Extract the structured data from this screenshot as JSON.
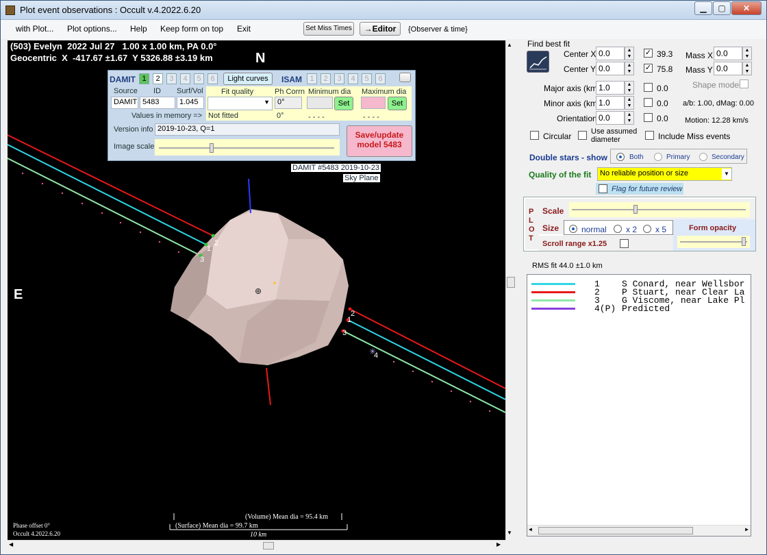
{
  "window": {
    "title": "Plot event observations : Occult v.4.2022.6.20"
  },
  "menu": [
    "with Plot...",
    "Plot options...",
    "Help",
    "Keep form on top",
    "Exit"
  ],
  "toolbar": {
    "set_miss_times": "Set Miss Times",
    "editor": "→Editor",
    "observer_time": "{Observer & time}"
  },
  "plot": {
    "header_line1": "(503) Evelyn  2022 Jul 27   1.00 x 1.00 km, PA 0.0°",
    "header_line2": "Geocentric  X  -417.67 ±1.67  Y 5326.88 ±3.19 km",
    "north_label": "N",
    "east_label": "E",
    "damit_caption": "DAMIT #5483 2019-10-23",
    "sky_plane": "Sky Plane",
    "phase_offset": "Phase offset 0°",
    "version": "Occult 4.2022.6.20",
    "volume_dia": "(Volume) Mean dia = 95.4 km",
    "surface_dia": "(Surface) Mean dia = 99.7 km",
    "scale_label": "10 km",
    "chord_labels": [
      "1",
      "2",
      "3",
      "1",
      "2",
      "3",
      "4"
    ]
  },
  "damit_panel": {
    "damit_label": "DAMIT",
    "damit_nums": [
      "1",
      "2",
      "3",
      "4",
      "5",
      "6"
    ],
    "light_curves": "Light curves",
    "isam_label": "ISAM",
    "isam_nums": [
      "1",
      "2",
      "3",
      "4",
      "5",
      "6"
    ],
    "source_hdr": "Source",
    "id_hdr": "ID",
    "surf_vol_hdr": "Surf/Vol",
    "source": "DAMIT",
    "id": "5483",
    "surf_vol": "1.045",
    "fit_quality_hdr": "Fit quality",
    "ph_corrn_hdr": "Ph Corrn",
    "min_dia_hdr": "Minimum dia",
    "max_dia_hdr": "Maximum dia",
    "ph_corrn": "0°",
    "set": "Set",
    "values_in_memory": "Values in memory =>",
    "not_fitted": "Not fitted",
    "mem_ph": "0°",
    "mem_min": "- - - -",
    "mem_max": "- - - -",
    "version_info_lbl": "Version info",
    "version_info": "2019-10-23, Q=1",
    "image_scale_lbl": "Image scale",
    "save_update": "Save/update model 5483"
  },
  "fit": {
    "find_best_fit": "Find best fit",
    "center_x_lbl": "Center X",
    "center_x": "0.0",
    "center_y_lbl": "Center Y",
    "center_y": "0.0",
    "cx_check_val": "39.3",
    "cy_check_val": "75.8",
    "mass_x_lbl": "Mass X",
    "mass_x": "0.0",
    "mass_y_lbl": "Mass Y",
    "mass_y": "0.0",
    "shape_model": "Shape model",
    "major_lbl": "Major axis (km)",
    "major": "1.0",
    "major_chk": "0.0",
    "minor_lbl": "Minor axis (km)",
    "minor": "1.0",
    "minor_chk": "0.0",
    "orient_lbl": "Orientation",
    "orient": "0.0",
    "orient_chk": "0.0",
    "ab_dmag": "a/b: 1.00, dMag: 0.00",
    "motion": "Motion: 12.28 km/s",
    "circular": "Circular",
    "use_assumed": "Use assumed diameter",
    "include_miss": "Include Miss events",
    "double_stars": "Double stars - show",
    "both": "Both",
    "primary": "Primary",
    "secondary": "Secondary",
    "quality_lbl": "Quality of the fit",
    "quality_val": "No reliable position or size",
    "flag_review": "Flag for future review"
  },
  "plotbox": {
    "plot_vert": [
      "P",
      "L",
      "O",
      "T"
    ],
    "scale": "Scale",
    "size": "Size",
    "normal": "normal",
    "x2": "x 2",
    "x5": "x 5",
    "form_opacity": "Form opacity",
    "scroll_range": "Scroll range x1.25"
  },
  "rms": "RMS fit 44.0 ±1.0 km",
  "legend": [
    {
      "num": "1",
      "name": "S Conard, near Wellsbor",
      "color": "#2fd6e6"
    },
    {
      "num": "2",
      "name": "P Stuart, near Clear La",
      "color": "#e8191a"
    },
    {
      "num": "3",
      "name": "G Viscome, near Lake Pl",
      "color": "#8ee8a8"
    },
    {
      "num": "4(P)",
      "name": "Predicted",
      "color": "#8a3fe0"
    }
  ]
}
